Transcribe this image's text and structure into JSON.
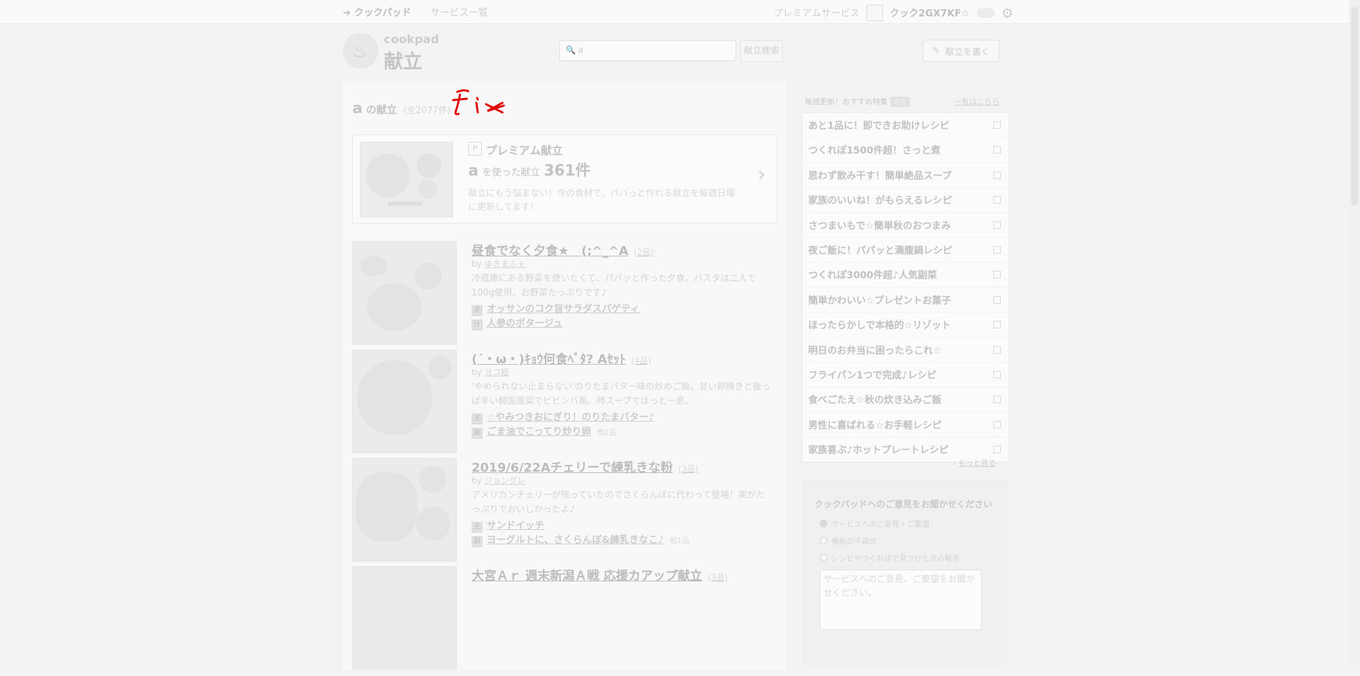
{
  "topbar": {
    "back_link": "クックパッド",
    "services": "サービス一覧",
    "premium": "プレミアムサービス",
    "username": "クック2GX7KF☆"
  },
  "header": {
    "brand": "cookpad",
    "product": "献立",
    "search_value": "a",
    "search_button": "献立検索",
    "write_button": "献立を書く"
  },
  "results": {
    "query": "a",
    "suffix": "の献立",
    "count_text": "(全2077件)"
  },
  "annotation": {
    "text": "fix",
    "color": "#e00000"
  },
  "premium": {
    "badge": "P",
    "title": "プレミアム献立",
    "query": "a",
    "mid": "を使った献立",
    "count": "361件",
    "desc": "献立にもう悩まない！今の食材で、パパっと作れる献立を毎週日曜に更新してます！"
  },
  "menus": [
    {
      "title": "昼食でなく夕食★　(;^_^A",
      "count": "(2品)",
      "by_prefix": "by",
      "author": "ゆきまふぇ",
      "desc": "冷蔵庫にある野菜を使いたくて、パパッと作った夕食。パスタは二人で100g使用。お野菜たっぷりです♪",
      "dishes": [
        {
          "icon": "主",
          "label": "オッサンのコク旨サラダスパゲティ",
          "extra": ""
        },
        {
          "icon": "汁",
          "label": "人参のポタージュ",
          "extra": ""
        }
      ]
    },
    {
      "title": "(´・ω・)ｷｮｳ何食ﾍﾞﾀ? Aｾｯﾄ",
      "count": "(4品)",
      "by_prefix": "by",
      "author": "ヨコ姫",
      "desc": "'やめられない止まらない'のりたまバター味の炒めご飯。甘い卵焼きと後っぱ辛い韓国風菜でビビンバ風。時スープでほっと一息。",
      "dishes": [
        {
          "icon": "主",
          "label": "☆やみつきおにぎり！のりたまバター♪",
          "extra": ""
        },
        {
          "icon": "副",
          "label": "ごま油でこってり炒り卵",
          "extra": "他2品"
        }
      ]
    },
    {
      "title": "2019/6/22Aチェリーで練乳きな粉",
      "count": "(3品)",
      "by_prefix": "by",
      "author": "ジョングレ",
      "desc": "アメリカンチェリーが残っていたのでさくらんぼに代わって登場！実がたっぷりでおいしかったよ♪",
      "dishes": [
        {
          "icon": "主",
          "label": "サンドイッチ",
          "extra": ""
        },
        {
          "icon": "副",
          "label": "ヨーグルトに、さくらんぼ&練乳きなこ♪",
          "extra": "他1品"
        }
      ]
    },
    {
      "title": "大宮Ａｒ 週末新潟Ａ戦 応援カアップ献立",
      "count": "(3品)",
      "by_prefix": "",
      "author": "",
      "desc": "",
      "dishes": []
    }
  ],
  "sidebar": {
    "heading": "毎週更新！おすすめ特集",
    "heading_badge": "広告",
    "heading_link": "一覧はこちら",
    "items": [
      "あと1品に！即できお助けレシピ",
      "つくれぽ1500件超！さっと煮",
      "思わず飲み干す！簡単絶品スープ",
      "家族のいいね！がもらえるレシピ",
      "さつまいもで☆簡単秋のおつまみ",
      "夜ご飯に！パパッと満腹鍋レシピ",
      "つくれぽ3000件超♪人気副菜",
      "簡単かわいい☆プレゼントお菓子",
      "ほったらかしで本格的☆リゾット",
      "明日のお弁当に困ったらこれ☆",
      "フライパン1つで完成♪レシピ",
      "食べごたえ☆秋の炊き込みご飯",
      "男性に喜ばれる☆お手軽レシピ",
      "家族喜ぶ♪ホットプレートレシピ"
    ],
    "more_prefix": "›",
    "more": "もっと見る"
  },
  "feedback": {
    "title": "クックパッドへのご意見をお聞かせください",
    "options": [
      "サービスへのご意見・ご要望",
      "機能の不具合",
      "レシピやつくれぽで見つけた点の報告"
    ],
    "placeholder": "サービスへのご意見、ご要望をお聞かせください。"
  }
}
